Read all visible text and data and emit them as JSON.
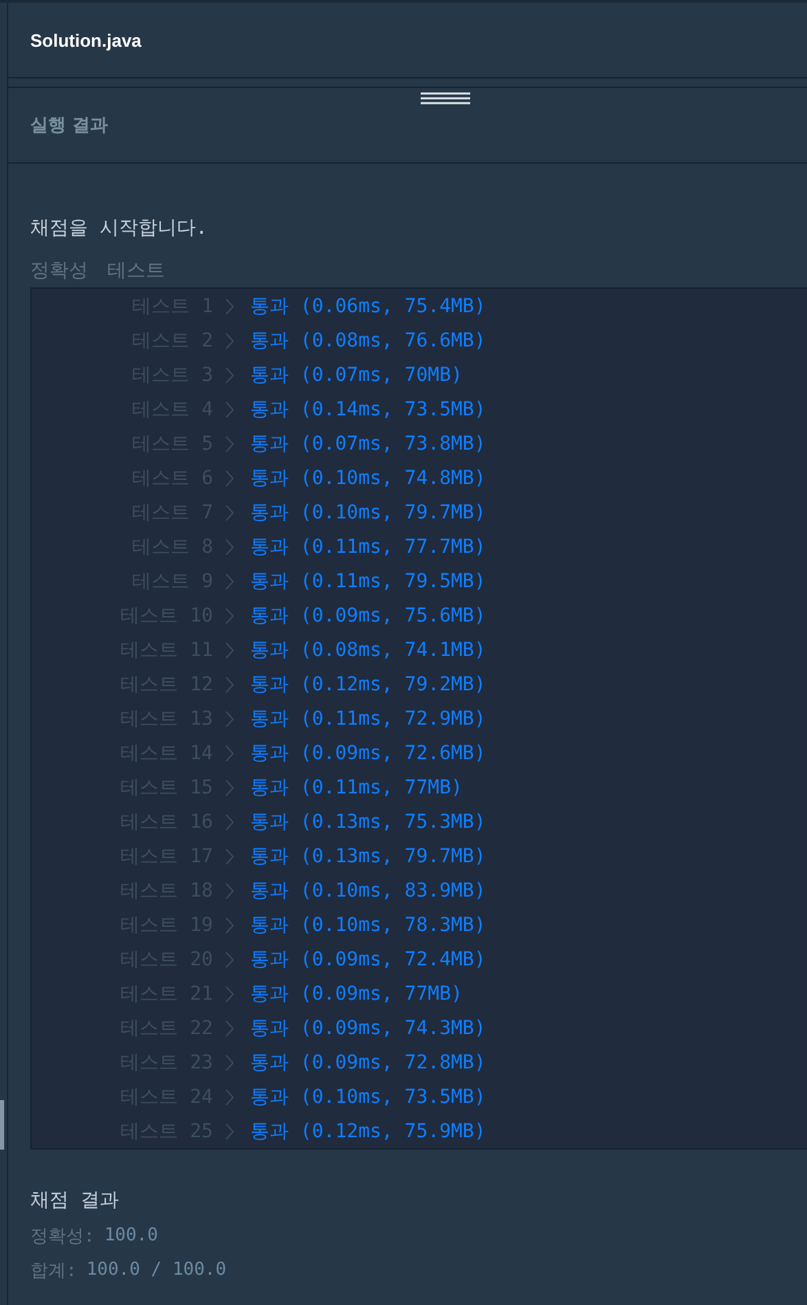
{
  "editor": {
    "file_title": "Solution.java"
  },
  "output_panel": {
    "title": "실행 결과"
  },
  "grading": {
    "start_message": "채점을 시작합니다.",
    "section_label": "정확성",
    "section_sublabel": "테스트",
    "tests": [
      {
        "label": "테스트 1",
        "result": "통과 (0.06ms, 75.4MB)"
      },
      {
        "label": "테스트 2",
        "result": "통과 (0.08ms, 76.6MB)"
      },
      {
        "label": "테스트 3",
        "result": "통과 (0.07ms, 70MB)"
      },
      {
        "label": "테스트 4",
        "result": "통과 (0.14ms, 73.5MB)"
      },
      {
        "label": "테스트 5",
        "result": "통과 (0.07ms, 73.8MB)"
      },
      {
        "label": "테스트 6",
        "result": "통과 (0.10ms, 74.8MB)"
      },
      {
        "label": "테스트 7",
        "result": "통과 (0.10ms, 79.7MB)"
      },
      {
        "label": "테스트 8",
        "result": "통과 (0.11ms, 77.7MB)"
      },
      {
        "label": "테스트 9",
        "result": "통과 (0.11ms, 79.5MB)"
      },
      {
        "label": "테스트 10",
        "result": "통과 (0.09ms, 75.6MB)"
      },
      {
        "label": "테스트 11",
        "result": "통과 (0.08ms, 74.1MB)"
      },
      {
        "label": "테스트 12",
        "result": "통과 (0.12ms, 79.2MB)"
      },
      {
        "label": "테스트 13",
        "result": "통과 (0.11ms, 72.9MB)"
      },
      {
        "label": "테스트 14",
        "result": "통과 (0.09ms, 72.6MB)"
      },
      {
        "label": "테스트 15",
        "result": "통과 (0.11ms, 77MB)"
      },
      {
        "label": "테스트 16",
        "result": "통과 (0.13ms, 75.3MB)"
      },
      {
        "label": "테스트 17",
        "result": "통과 (0.13ms, 79.7MB)"
      },
      {
        "label": "테스트 18",
        "result": "통과 (0.10ms, 83.9MB)"
      },
      {
        "label": "테스트 19",
        "result": "통과 (0.10ms, 78.3MB)"
      },
      {
        "label": "테스트 20",
        "result": "통과 (0.09ms, 72.4MB)"
      },
      {
        "label": "테스트 21",
        "result": "통과 (0.09ms, 77MB)"
      },
      {
        "label": "테스트 22",
        "result": "통과 (0.09ms, 74.3MB)"
      },
      {
        "label": "테스트 23",
        "result": "통과 (0.09ms, 72.8MB)"
      },
      {
        "label": "테스트 24",
        "result": "통과 (0.10ms, 73.5MB)"
      },
      {
        "label": "테스트 25",
        "result": "통과 (0.12ms, 75.9MB)"
      }
    ],
    "summary_title": "채점 결과",
    "summary": [
      {
        "label": "정확성:",
        "value": "100.0"
      },
      {
        "label": "합계:",
        "value": "100.0 / 100.0"
      }
    ]
  }
}
